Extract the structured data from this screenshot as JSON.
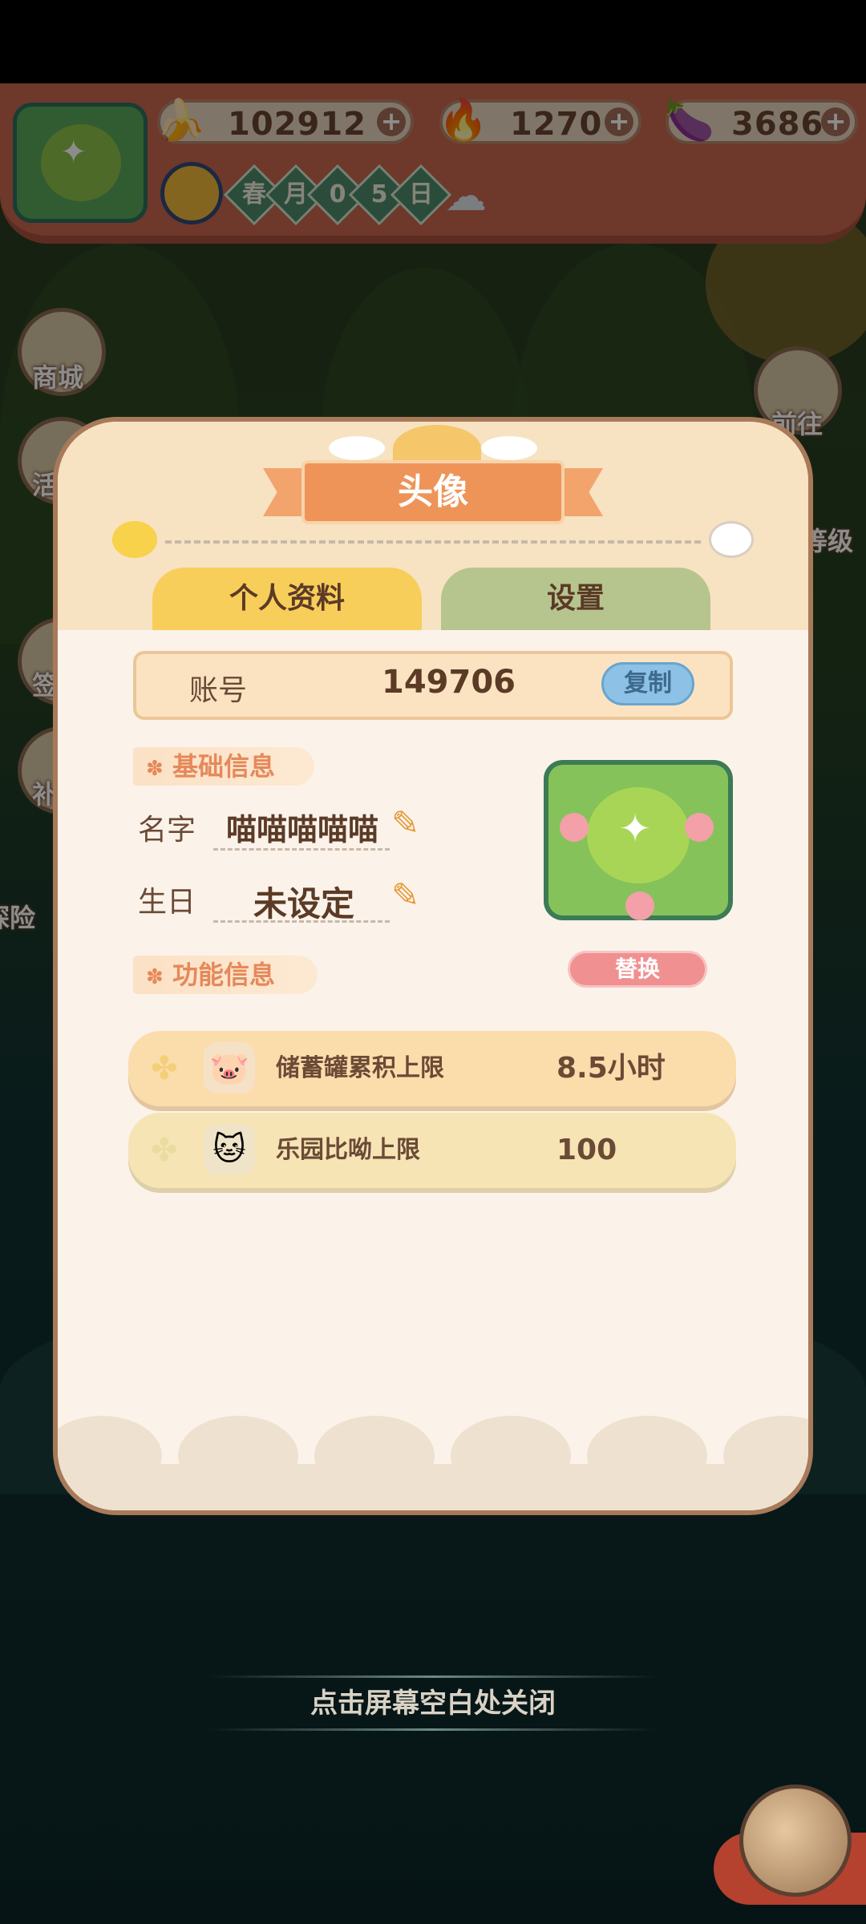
{
  "hud": {
    "resources": [
      {
        "icon": "banana-icon",
        "value": "102912"
      },
      {
        "icon": "blue-flame-icon",
        "value": "1270"
      },
      {
        "icon": "eggplant-icon",
        "value": "3686"
      }
    ],
    "date_chars": [
      "春",
      "月",
      "0",
      "5",
      "日"
    ],
    "weather_icon": "rain-cloud-icon"
  },
  "side_menu": {
    "left": [
      "商城",
      "活",
      "签",
      "补",
      "探险"
    ],
    "right": [
      "前往",
      "等级"
    ]
  },
  "dialog": {
    "title": "头像",
    "tabs": {
      "profile": "个人资料",
      "settings": "设置"
    },
    "account": {
      "label": "账号",
      "value": "149706",
      "copy": "复制"
    },
    "basic_section": "基础信息",
    "name": {
      "label": "名字",
      "value": "喵喵喵喵喵"
    },
    "birthday": {
      "label": "生日",
      "value": "未设定"
    },
    "replace_button": "替换",
    "function_section": "功能信息",
    "function_rows": [
      {
        "label": "储蓄罐累积上限",
        "value": "8.5小时"
      },
      {
        "label": "乐园比呦上限",
        "value": "100"
      }
    ]
  },
  "close_hint": "点击屏幕空白处关闭"
}
